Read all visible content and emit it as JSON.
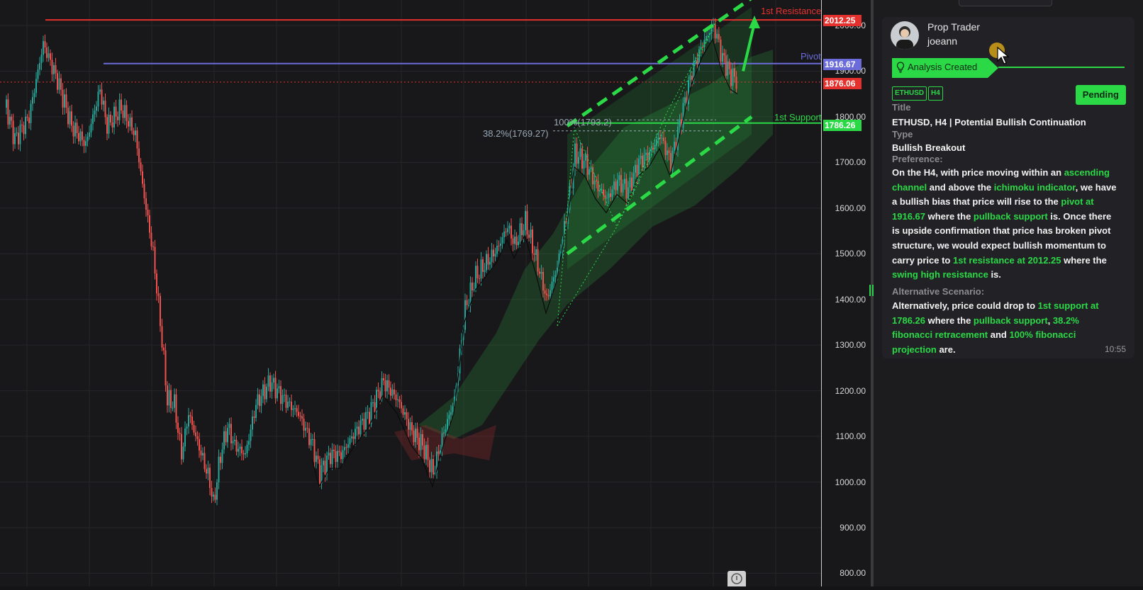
{
  "chart": {
    "price_ticks": [
      "2000.00",
      "1900.00",
      "1800.00",
      "1700.00",
      "1600.00",
      "1500.00",
      "1400.00",
      "1300.00",
      "1200.00",
      "1100.00",
      "1000.00",
      "900.00",
      "800.00"
    ],
    "tick_values": [
      2000,
      1900,
      1800,
      1700,
      1600,
      1500,
      1400,
      1300,
      1200,
      1100,
      1000,
      900,
      800
    ],
    "levels": {
      "resistance": {
        "label": "1st Resistance",
        "value": "2012.25",
        "price": 2012.25,
        "color": "#e5312d"
      },
      "pivot": {
        "label": "Pivot",
        "value": "1916.67",
        "price": 1916.67,
        "color": "#6b6bd9"
      },
      "current": {
        "value": "1876.06",
        "price": 1876.06,
        "color": "#e5312d"
      },
      "support": {
        "label": "1st Support",
        "value": "1786.26",
        "price": 1786.26,
        "color": "#2bd947"
      }
    },
    "fib_retracement": {
      "label": "38.2%(1769.27)",
      "price": 1769.27
    },
    "fib_projection": {
      "label": "100%(1793.2)",
      "price": 1793.2
    },
    "colors": {
      "up": "#26a69a",
      "down": "#ef5350",
      "accent": "#2bd947",
      "grid": "#2a2a2e"
    }
  },
  "panel": {
    "author_role": "Prop Trader",
    "author_name": "joeann",
    "status": "Analysis Created",
    "tags": [
      "ETHUSD",
      "H4"
    ],
    "pending_label": "Pending",
    "title_label": "Title",
    "title_value": "ETHUSD, H4 | Potential Bullish Continuation",
    "type_label": "Type",
    "type_value": "Bullish Breakout",
    "preference_label": "Preference:",
    "preference_segments": [
      {
        "t": "On the H4, with price moving within an "
      },
      {
        "t": "ascending channel",
        "h": true
      },
      {
        "t": " and above the "
      },
      {
        "t": "ichimoku indicator",
        "h": true
      },
      {
        "t": ", we have a bullish bias that price will rise to the "
      },
      {
        "t": "pivot at 1916.67",
        "h": true
      },
      {
        "t": " where the "
      },
      {
        "t": "pullback support",
        "h": true
      },
      {
        "t": " is. Once there is upside confirmation that price has broken pivot structure, we would expect bullish momentum to carry price to "
      },
      {
        "t": "1st resistance at 2012.25",
        "h": true
      },
      {
        "t": " where the "
      },
      {
        "t": "swing high resistance",
        "h": true
      },
      {
        "t": " is."
      }
    ],
    "alternative_label": "Alternative Scenario:",
    "alternative_segments": [
      {
        "t": "Alternatively, price could drop to "
      },
      {
        "t": "1st support at 1786.26",
        "h": true
      },
      {
        "t": " where the "
      },
      {
        "t": "pullback support",
        "h": true
      },
      {
        "t": ", "
      },
      {
        "t": "38.2% fibonacci retracement",
        "h": true
      },
      {
        "t": " and "
      },
      {
        "t": "100% fibonacci projection",
        "h": true
      },
      {
        "t": " are."
      }
    ],
    "time": "10:55"
  },
  "icons": {
    "bulb": "lightbulb-icon",
    "cursor": "mouse-pointer-icon",
    "avatar": "user-avatar"
  }
}
